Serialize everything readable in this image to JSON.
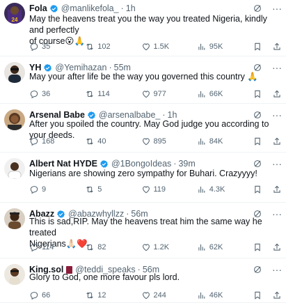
{
  "tweets": [
    {
      "name": "Fola",
      "handle": "@manlikefola_",
      "time": "1h",
      "text1": "May the heavens treat you the way you treated Nigeria, kindly and perfectly",
      "text2": "of course😮🙏",
      "replies": "35",
      "retweets": "102",
      "likes": "1.5K",
      "views": "95K"
    },
    {
      "name": "YH",
      "handle": "@Yemihazan",
      "time": "55m",
      "text1": "May your after life be the way you governed this country 🙏",
      "replies": "36",
      "retweets": "114",
      "likes": "977",
      "views": "66K"
    },
    {
      "name": "Arsenal Babe",
      "handle": "@arsenalbabe_",
      "time": "1h",
      "text1": "After you spoiled the country. May God judge you according to your deeds.",
      "replies": "168",
      "retweets": "40",
      "likes": "895",
      "views": "84K"
    },
    {
      "name": "Albert Nat HYDE",
      "handle": "@1BongoIdeas",
      "time": "39m",
      "text1": "Nigerians are showing zero sympathy for Buhari. Crazyyyy!",
      "replies": "9",
      "retweets": "5",
      "likes": "119",
      "views": "4.3K"
    },
    {
      "name": "Abazz",
      "handle": "@abazwhyllzz",
      "time": "56m",
      "text1": "This is sad,RIP. May the heavens treat him the same way he treated",
      "text2": "Nigerians🙏🏻❤️",
      "replies": "114",
      "retweets": "82",
      "likes": "1.2K",
      "views": "62K"
    },
    {
      "name": "King.sol",
      "handle": "@teddi_speaks",
      "time": "56m",
      "text1": "Glory to God, one more favour pls lord.",
      "replies": "66",
      "retweets": "12",
      "likes": "244",
      "views": "46K"
    }
  ],
  "colors": {
    "verified": "#1d9bf0",
    "muted": "#536471",
    "text": "#0f1419",
    "divider": "#eff3f4"
  },
  "icons": [
    "reply-icon",
    "retweet-icon",
    "like-icon",
    "views-icon",
    "bookmark-icon",
    "share-icon",
    "grok-icon",
    "more-icon",
    "verified-badge-icon"
  ]
}
